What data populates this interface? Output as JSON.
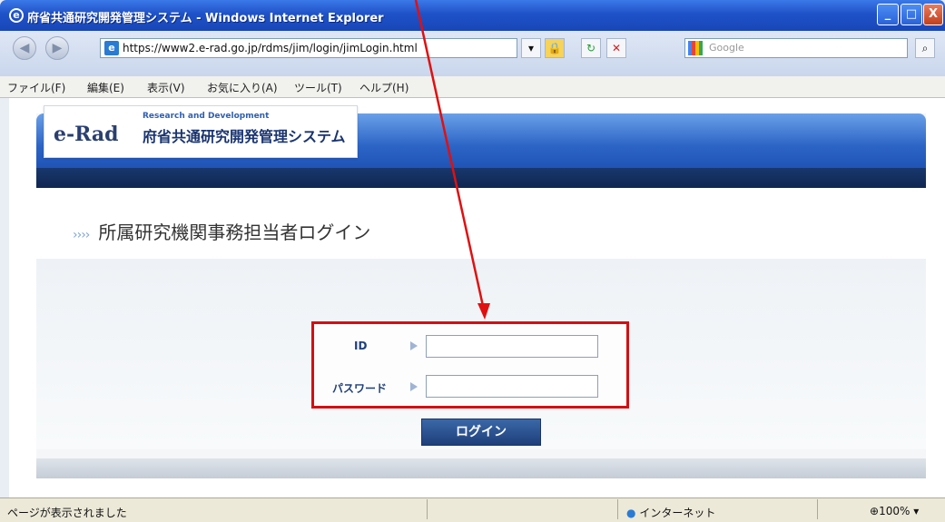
{
  "window": {
    "title": "府省共通研究開発管理システム - Windows Internet Explorer",
    "min": "_",
    "max": "□",
    "close": "X"
  },
  "address": {
    "url": "https://www2.e-rad.go.jp/rdms/jim/login/jimLogin.html",
    "search_placeholder": "Google"
  },
  "menu": [
    "ファイル(F)",
    "編集(E)",
    "表示(V)",
    "お気に入り(A)",
    "ツール(T)",
    "ヘルプ(H)"
  ],
  "logo": {
    "brand": "e-Rad",
    "subtitle": "Research and Development",
    "name": "府省共通研究開発管理システム"
  },
  "page": {
    "arrows": "››››",
    "title": "所属研究機関事務担当者ログイン"
  },
  "form": {
    "id_label": "ID",
    "password_label": "パスワード",
    "login_button": "ログイン",
    "id_value": "",
    "password_value": ""
  },
  "status": {
    "text": "ページが表示されました",
    "zone": "インターネット",
    "zoom": "100%"
  },
  "colors": {
    "annotation": "#e01010"
  }
}
